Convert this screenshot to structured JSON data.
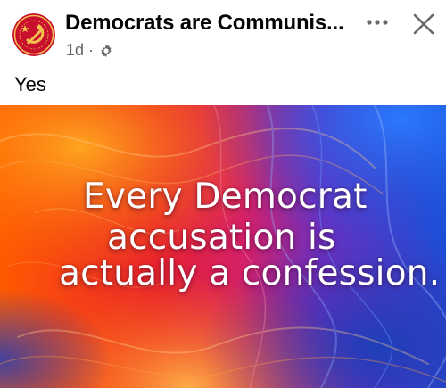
{
  "post": {
    "page_name": "Democrats are Communis...",
    "time": "1d",
    "separator": "·",
    "text": "Yes"
  },
  "icons": {
    "avatar": "hammer-and-sickle-logo",
    "privacy": "gear-icon",
    "more": "more-options-icon",
    "close": "close-icon"
  },
  "image": {
    "lines": [
      "Every Democrat",
      "accusation is",
      "actually a confession."
    ]
  },
  "colors": {
    "avatar_red": "#c8102e",
    "avatar_gold": "#f2c14e",
    "meta_gray": "#65676b",
    "image_orange": "#ff6a00",
    "image_red": "#e8232e",
    "image_blue": "#1a4fd8"
  }
}
